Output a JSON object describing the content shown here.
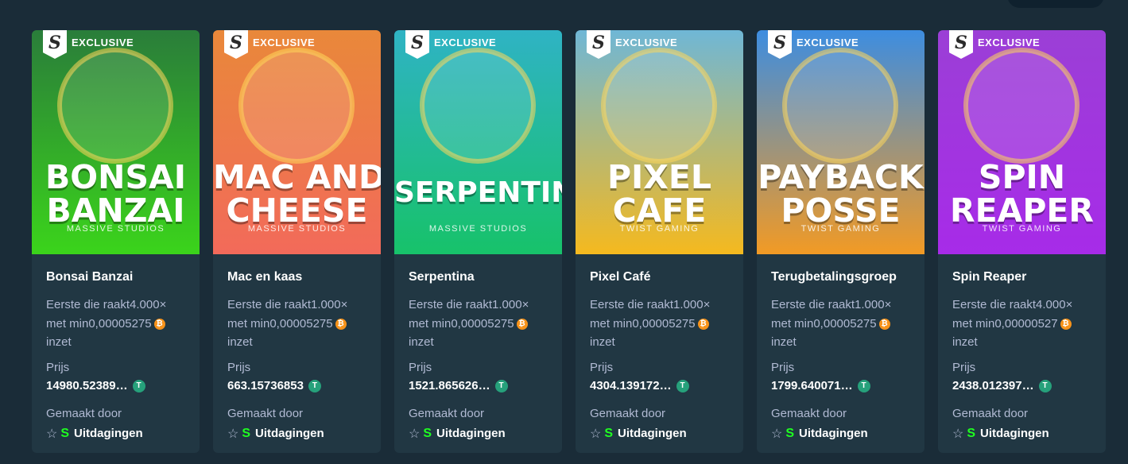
{
  "header": {
    "pill_label": ""
  },
  "cards": [
    {
      "title_lines": [
        "BONSAI",
        "BANZAI"
      ],
      "studio": "MASSIVE STUDIOS",
      "badge": "EXCLUSIVE",
      "badge_letter": "S",
      "name": "Bonsai Banzai",
      "desc_line1": "Eerste die raakt4.000×",
      "desc_line2": "met min0,00005275",
      "desc_line3": "inzet",
      "price_label": "Prijs",
      "price": "14980.52389…",
      "made_label": "Gemaakt door",
      "maker_logo": "S",
      "maker": "Uitdagingen",
      "colors": {
        "top": "#2a7d3a",
        "bottom": "#3bd41b"
      }
    },
    {
      "title_lines": [
        "MAC AND",
        "CHEESE"
      ],
      "studio": "MASSIVE STUDIOS",
      "badge": "EXCLUSIVE",
      "badge_letter": "S",
      "name": "Mac en kaas",
      "desc_line1": "Eerste die raakt1.000×",
      "desc_line2": "met min0,00005275",
      "desc_line3": "inzet",
      "price_label": "Prijs",
      "price": "663.15736853",
      "made_label": "Gemaakt door",
      "maker_logo": "S",
      "maker": "Uitdagingen",
      "colors": {
        "top": "#e9883a",
        "bottom": "#f26a5a"
      }
    },
    {
      "title_lines": [
        "SERPENTINA"
      ],
      "studio": "MASSIVE STUDIOS",
      "badge": "EXCLUSIVE",
      "badge_letter": "S",
      "name": "Serpentina",
      "desc_line1": "Eerste die raakt1.000×",
      "desc_line2": "met min0,00005275",
      "desc_line3": "inzet",
      "price_label": "Prijs",
      "price": "1521.865626…",
      "made_label": "Gemaakt door",
      "maker_logo": "S",
      "maker": "Uitdagingen",
      "colors": {
        "top": "#2fb3c4",
        "bottom": "#17c26a"
      }
    },
    {
      "title_lines": [
        "PIXEL",
        "CAFE"
      ],
      "studio": "TWIST GAMING",
      "badge": "EXCLUSIVE",
      "badge_letter": "S",
      "name": "Pixel Café",
      "desc_line1": "Eerste die raakt1.000×",
      "desc_line2": "met min0,00005275",
      "desc_line3": "inzet",
      "price_label": "Prijs",
      "price": "4304.139172…",
      "made_label": "Gemaakt door",
      "maker_logo": "S",
      "maker": "Uitdagingen",
      "colors": {
        "top": "#6fb7d6",
        "bottom": "#f5b91e"
      }
    },
    {
      "title_lines": [
        "PAYBACK",
        "POSSE"
      ],
      "studio": "TWIST GAMING",
      "badge": "EXCLUSIVE",
      "badge_letter": "S",
      "name": "Terugbetalingsgroep",
      "desc_line1": "Eerste die raakt1.000×",
      "desc_line2": "met min0,00005275",
      "desc_line3": "inzet",
      "price_label": "Prijs",
      "price": "1799.640071…",
      "made_label": "Gemaakt door",
      "maker_logo": "S",
      "maker": "Uitdagingen",
      "colors": {
        "top": "#3d8de0",
        "bottom": "#f29a24"
      }
    },
    {
      "title_lines": [
        "SPIN",
        "REAPER"
      ],
      "studio": "TWIST GAMING",
      "badge": "EXCLUSIVE",
      "badge_letter": "S",
      "name": "Spin Reaper",
      "desc_line1": "Eerste die raakt4.000×",
      "desc_line2": "met min0,00000527",
      "desc_line3": "inzet",
      "price_label": "Prijs",
      "price": "2438.012397…",
      "made_label": "Gemaakt door",
      "maker_logo": "S",
      "maker": "Uitdagingen",
      "colors": {
        "top": "#9b3fd6",
        "bottom": "#a72be8"
      }
    }
  ],
  "icons": {
    "btc": "bitcoin-coin-icon",
    "usdt": "tether-coin-icon",
    "star": "star-outline-icon"
  }
}
